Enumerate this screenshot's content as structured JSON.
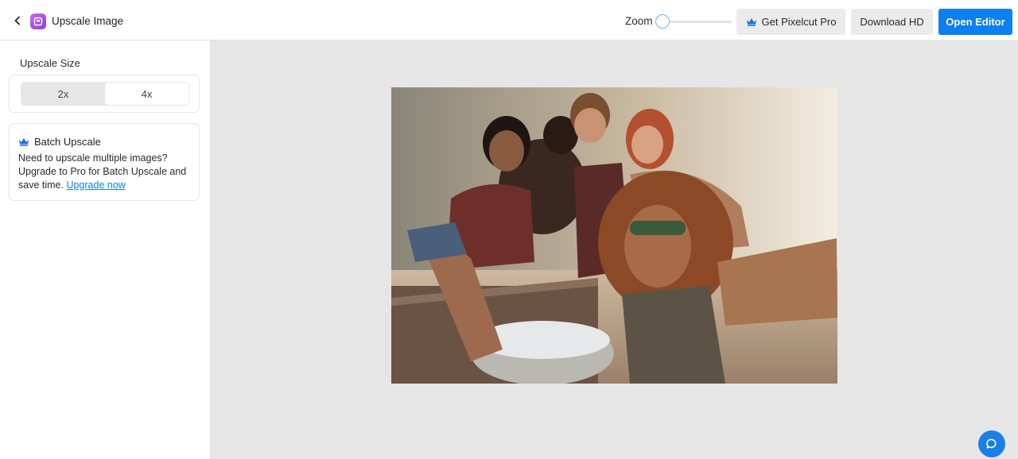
{
  "header": {
    "title": "Upscale Image",
    "back_icon": "chevron-left-icon",
    "app_icon": "upscale-app-icon",
    "zoom_label": "Zoom",
    "zoom_level": 0,
    "get_pro_label": "Get Pixelcut Pro",
    "download_label": "Download HD",
    "open_editor_label": "Open Editor"
  },
  "sidebar": {
    "upscale_size_heading": "Upscale Size",
    "size_options": [
      "2x",
      "4x"
    ],
    "selected_size": "4x",
    "batch": {
      "title": "Batch Upscale",
      "icon": "crown-icon",
      "text": "Need to upscale multiple images? Upgrade to Pro for Batch Upscale and save time.",
      "link": "Upgrade now"
    }
  },
  "canvas": {
    "image_alt": "",
    "help_icon": "chat-bubble-icon"
  },
  "colors": {
    "accent": "#0d7ff0",
    "canvas_bg": "#e6e6e6",
    "button_bg": "#ebebeb"
  }
}
